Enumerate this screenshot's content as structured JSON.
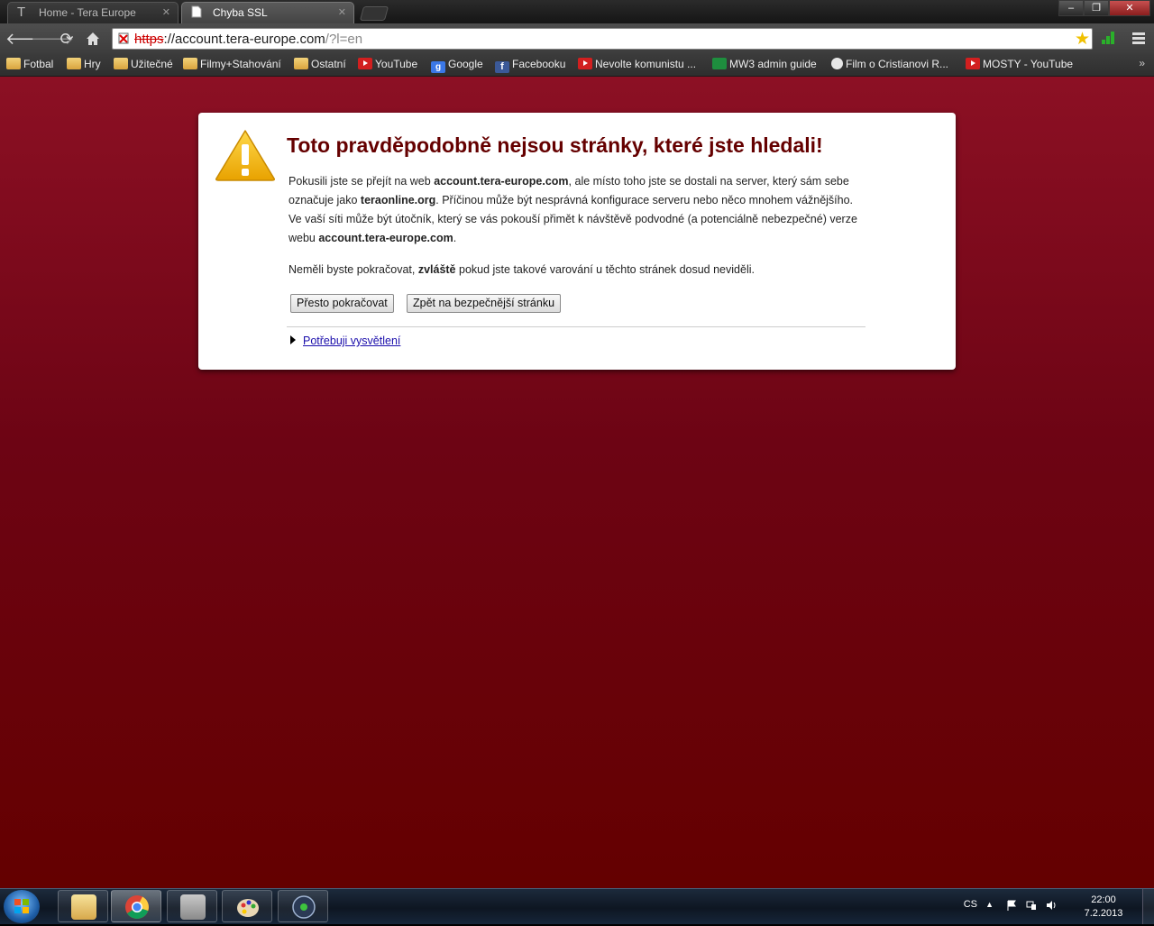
{
  "tabs": [
    {
      "title": "Home - Tera Europe",
      "favicon": "T",
      "active": false
    },
    {
      "title": "Chyba SSL",
      "favicon": "page-icon",
      "active": true
    }
  ],
  "omnibox": {
    "scheme": "https",
    "host": "://account.tera-europe.com",
    "rest": "/?l=en"
  },
  "bookmarks": [
    {
      "label": "Fotbal",
      "icon": "folder"
    },
    {
      "label": "Hry",
      "icon": "folder"
    },
    {
      "label": "Užitečné",
      "icon": "folder"
    },
    {
      "label": "Filmy+Stahování",
      "icon": "folder"
    },
    {
      "label": "Ostatní",
      "icon": "folder"
    },
    {
      "label": "YouTube",
      "icon": "yt"
    },
    {
      "label": "Google",
      "icon": "g"
    },
    {
      "label": "Facebooku",
      "icon": "fb"
    },
    {
      "label": "Nevolte komunistu ...",
      "icon": "yt"
    },
    {
      "label": "MW3 admin guide",
      "icon": "sheet"
    },
    {
      "label": "Film o Cristianovi R...",
      "icon": "rm"
    },
    {
      "label": "MOSTY - YouTube",
      "icon": "yt"
    }
  ],
  "bookmarks_more": "»",
  "warning": {
    "title": "Toto pravděpodobně nejsou stránky, které jste hledali!",
    "p1_a": "Pokusili jste se přejít na web ",
    "p1_b": "account.tera-europe.com",
    "p1_c": ", ale místo toho jste se dostali na server, který sám sebe označuje jako ",
    "p1_d": "teraonline.org",
    "p1_e": ". Příčinou může být nesprávná konfigurace serveru nebo něco mnohem vážnějšího. Ve vaší síti může být útočník, který se vás pokouší přimět k návštěvě podvodné (a potenciálně nebezpečné) verze webu ",
    "p1_f": "account.tera-europe.com",
    "p1_g": ".",
    "p2_a": "Neměli byste pokračovat, ",
    "p2_b": "zvláště",
    "p2_c": " pokud jste takové varování u těchto stránek dosud neviděli.",
    "proceed_label": "Přesto pokračovat",
    "back_label": "Zpět na bezpečnější stránku",
    "help_label": "Potřebuji vysvětlení"
  },
  "tray": {
    "language": "CS",
    "time": "22:00",
    "date": "7.2.2013"
  },
  "window_controls": {
    "minimize": "–",
    "maximize": "❐",
    "close": "✕"
  },
  "colors": {
    "title_red": "#650000",
    "page_bg_top": "#8c1024",
    "page_bg_bottom": "#640000",
    "link": "#1a0dab"
  }
}
